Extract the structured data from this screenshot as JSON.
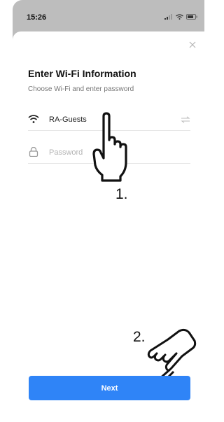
{
  "status_bar": {
    "time": "15:26",
    "icons": [
      "signal-icon",
      "wifi-icon",
      "battery-icon"
    ]
  },
  "dialog": {
    "close_icon": "close-icon",
    "title": "Enter Wi-Fi Information",
    "subtitle": "Choose Wi-Fi and enter password",
    "wifi_field": {
      "icon": "wifi-icon",
      "value": "RA-Guests",
      "action_icon": "switch-network-icon"
    },
    "password_field": {
      "icon": "lock-icon",
      "placeholder": "Password",
      "value": ""
    },
    "next_label": "Next"
  },
  "annotations": {
    "step1": "1.",
    "step2": "2.",
    "hand_icons": [
      "pointing-hand-icon",
      "tapping-hand-icon"
    ]
  },
  "colors": {
    "accent": "#2f84f7",
    "backdrop": "#bdbdbd",
    "placeholder": "#b3b3b3"
  }
}
